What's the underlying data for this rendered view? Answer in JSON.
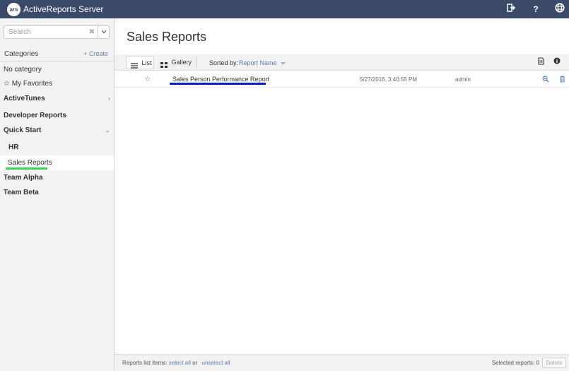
{
  "app": {
    "logo_text": "ars",
    "title": "ActiveReports Server"
  },
  "top_icons": [
    "sign-out-icon",
    "help-icon",
    "globe-icon"
  ],
  "help_label": "?",
  "sidebar": {
    "search_placeholder": "Search",
    "search_clear": "✖",
    "categories_label": "Categories",
    "create_label": "+ Create",
    "items": [
      {
        "label": "No category"
      },
      {
        "label": "☆ My Favorites"
      },
      {
        "label": "ActiveTunes",
        "chevron": "›"
      },
      {
        "label": "Developer Reports"
      },
      {
        "label": "Quick Start",
        "chevron": "⌄"
      },
      {
        "label": "HR"
      },
      {
        "label": "Sales Reports",
        "selected": true
      },
      {
        "label": "Team Alpha"
      },
      {
        "label": "Team Beta"
      }
    ]
  },
  "main": {
    "title": "Sales Reports",
    "toolbar": {
      "list_label": "List",
      "gallery_label": "Gallery",
      "sorted_by_label": "Sorted by:",
      "sorted_by_value": "Report Name"
    },
    "reports": [
      {
        "name": "Sales Person Performance Report",
        "date": "5/27/2016, 3:40:55 PM",
        "owner": "admin"
      }
    ]
  },
  "footer": {
    "list_items_label": "Reports list items:",
    "select_all": "select all",
    "or": "or",
    "unselect_all": "unselect all",
    "selected_label": "Selected reports: 0",
    "delete_label": "Delete"
  },
  "colors": {
    "topbar": "#3b4a68",
    "link": "#5d7db2",
    "highlight_green": "#39d353",
    "highlight_blue": "#0a21c8"
  }
}
